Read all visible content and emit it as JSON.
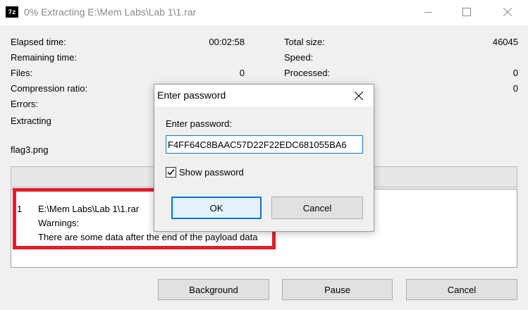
{
  "window": {
    "title": "0% Extracting E:\\Mem Labs\\Lab 1\\1.rar",
    "icon_text": "7z"
  },
  "stats_left": [
    {
      "label": "Elapsed time:",
      "value": "00:02:58"
    },
    {
      "label": "Remaining time:",
      "value": ""
    },
    {
      "label": "Files:",
      "value": "0"
    },
    {
      "label": "Compression ratio:",
      "value": ""
    },
    {
      "label": "Errors:",
      "value": ""
    }
  ],
  "stats_right": [
    {
      "label": "Total size:",
      "value": "46045"
    },
    {
      "label": "Speed:",
      "value": ""
    },
    {
      "label": "Processed:",
      "value": "0"
    },
    {
      "label": "",
      "value": "0"
    }
  ],
  "status": {
    "operation": "Extracting",
    "current_file": "flag3.png"
  },
  "log": {
    "index": "1",
    "lines": [
      "E:\\Mem Labs\\Lab 1\\1.rar",
      "Warnings:",
      "There are some data after the end of the payload data"
    ]
  },
  "buttons": {
    "background": "Background",
    "pause": "Pause",
    "cancel": "Cancel"
  },
  "dialog": {
    "title": "Enter password",
    "prompt": "Enter password:",
    "password_value": "F4FF64C8BAAC57D22F22EDC681055BA6",
    "show_password_label": "Show password",
    "show_password_checked": true,
    "ok_label": "OK",
    "cancel_label": "Cancel"
  },
  "colors": {
    "highlight": "#e0202a",
    "focus": "#0078d7"
  }
}
